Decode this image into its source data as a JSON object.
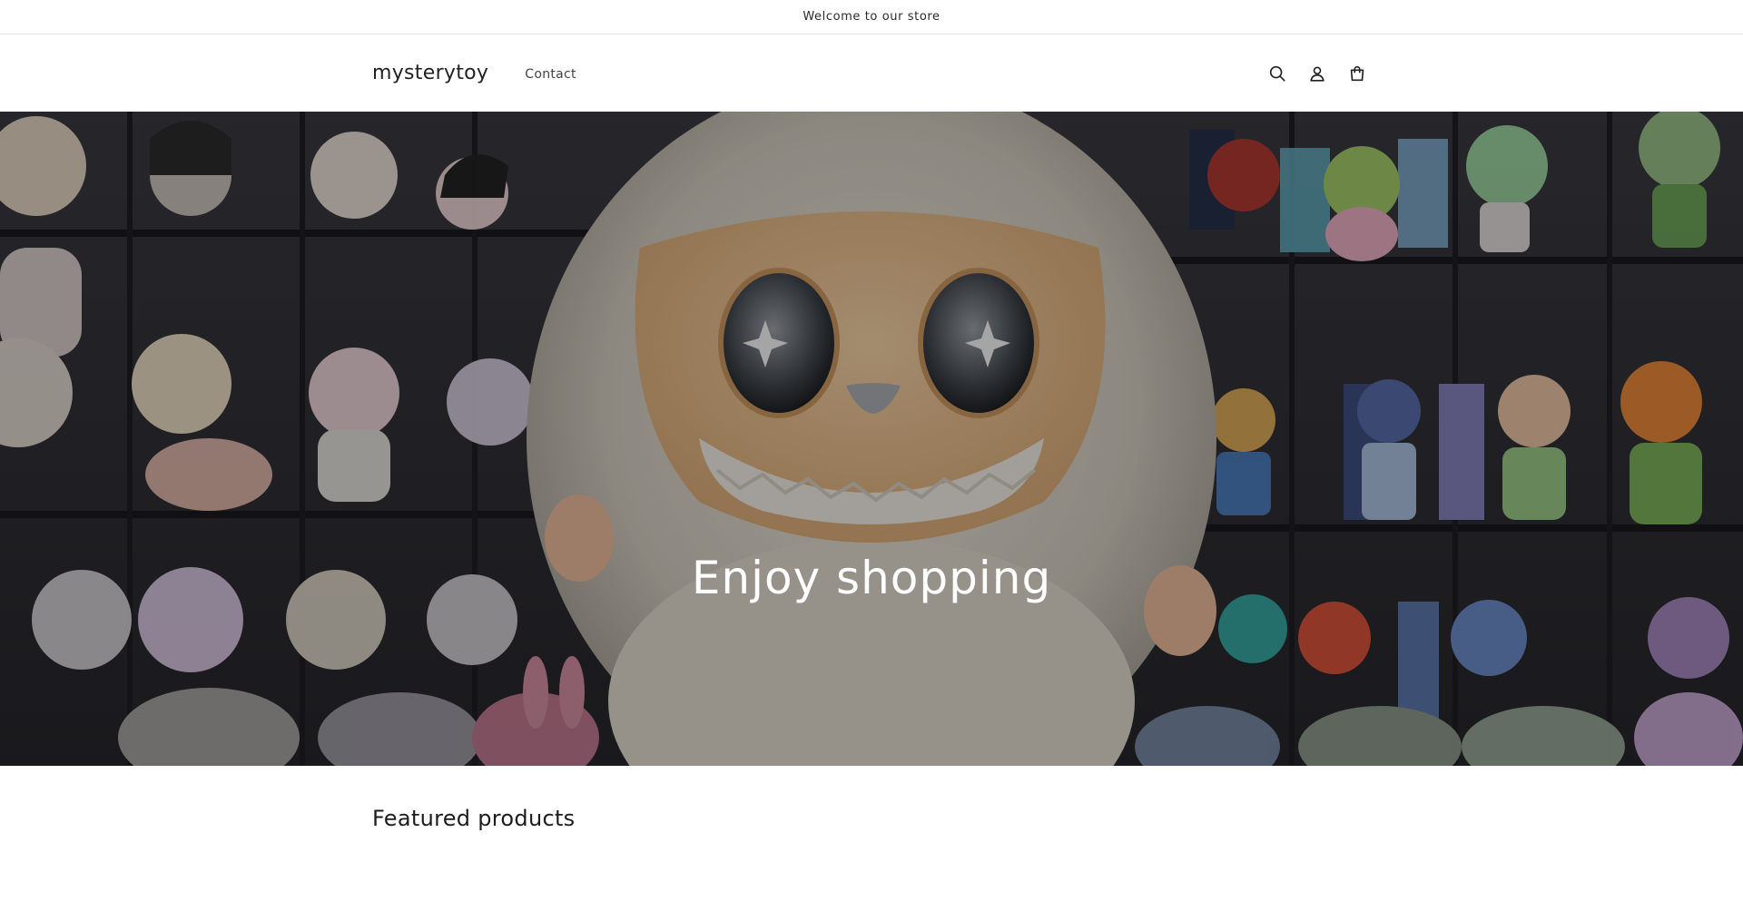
{
  "announcement": {
    "text": "Welcome to our store"
  },
  "header": {
    "logo": "mysterytoy",
    "nav": [
      {
        "label": "Contact"
      }
    ],
    "icons": [
      "search-icon",
      "account-icon",
      "cart-icon"
    ]
  },
  "hero": {
    "heading": "Enjoy shopping"
  },
  "featured": {
    "title": "Featured products"
  }
}
